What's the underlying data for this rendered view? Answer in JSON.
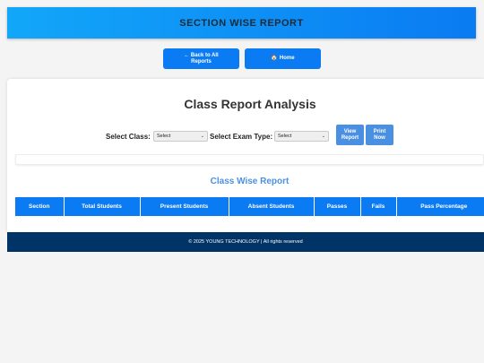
{
  "header": {
    "title": "SECTION WISE REPORT"
  },
  "nav": {
    "back_line1": "← Back to All",
    "back_line2": "Reports",
    "home_icon": "🏠",
    "home_label": "Home"
  },
  "main": {
    "title": "Class Report Analysis",
    "filters": {
      "class_label": "Select Class:",
      "class_value": "Select",
      "exam_label": "Select Exam Type:",
      "exam_value": "Select",
      "view_line1": "View",
      "view_line2": "Report",
      "print_line1": "Print",
      "print_line2": "Now"
    },
    "subtitle": "Class Wise Report",
    "table": {
      "columns": [
        "Section",
        "Total Students",
        "Present Students",
        "Absent Students",
        "Passes",
        "Fails",
        "Pass Percentage"
      ]
    }
  },
  "footer": {
    "text": "© 2025 YOUNG TECHNOLOGY | All rights reserved"
  },
  "colors": {
    "primary": "#0a7bf2",
    "secondary_button": "#4a90e2",
    "footer": "#003366",
    "page_background": "#f4f4f4"
  }
}
